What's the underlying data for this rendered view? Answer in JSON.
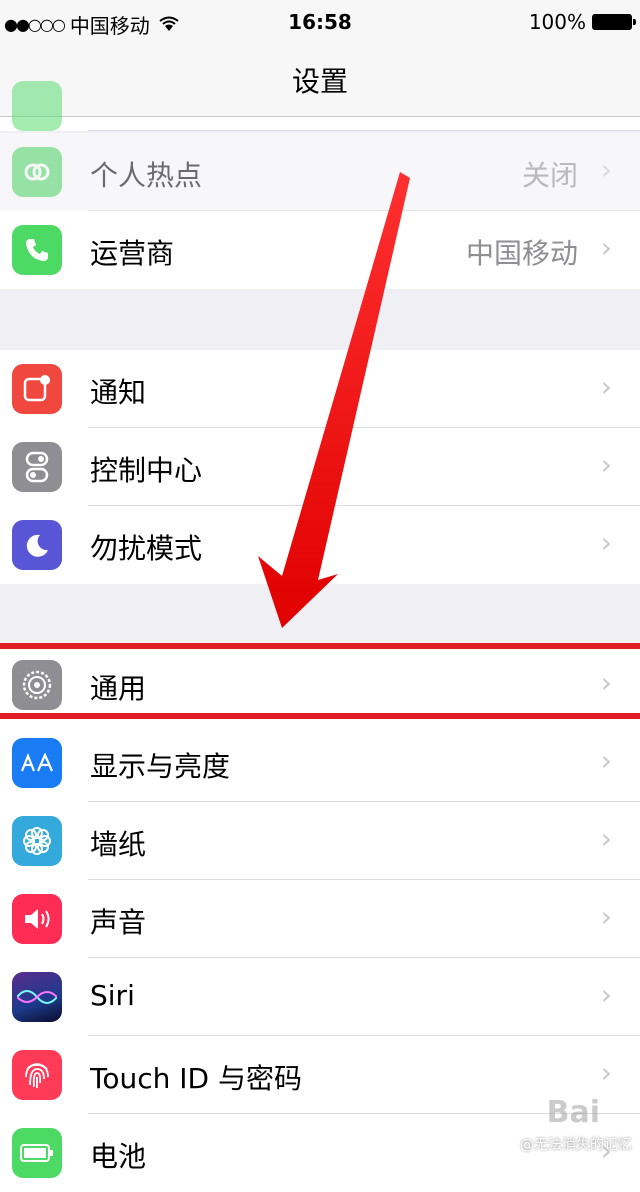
{
  "status_bar": {
    "signal": "●●○○○",
    "carrier": "中国移动",
    "time": "16:58",
    "battery": "100%"
  },
  "nav": {
    "title": "设置"
  },
  "rows": [
    {
      "label": "个人热点",
      "value": "关闭",
      "icon": "hotspot-icon",
      "color": "#4cd964"
    },
    {
      "label": "运营商",
      "value": "中国移动",
      "icon": "phone-icon",
      "color": "#4cd964"
    },
    {
      "label": "通知",
      "icon": "notifications-icon",
      "color": "#f0473f"
    },
    {
      "label": "控制中心",
      "icon": "control-center-icon",
      "color": "#8e8e93"
    },
    {
      "label": "勿扰模式",
      "icon": "moon-icon",
      "color": "#5856d6"
    },
    {
      "label": "通用",
      "icon": "gear-icon",
      "color": "#8e8e93"
    },
    {
      "label": "显示与亮度",
      "icon": "display-icon",
      "color": "#1a7cf5"
    },
    {
      "label": "墙纸",
      "icon": "wallpaper-icon",
      "color": "#34aadc"
    },
    {
      "label": "声音",
      "icon": "speaker-icon",
      "color": "#ff2d55"
    },
    {
      "label": "Siri",
      "icon": "siri-icon",
      "color": "#2a2a5a"
    },
    {
      "label": "Touch ID 与密码",
      "icon": "fingerprint-icon",
      "color": "#ff3b58"
    },
    {
      "label": "电池",
      "icon": "battery-icon",
      "color": "#4cd964"
    }
  ],
  "chevron": "›",
  "watermark": {
    "brand": "Bai",
    "credit": "@无法消失的记忆"
  },
  "annotation": {
    "highlight_color": "#e11c24"
  }
}
